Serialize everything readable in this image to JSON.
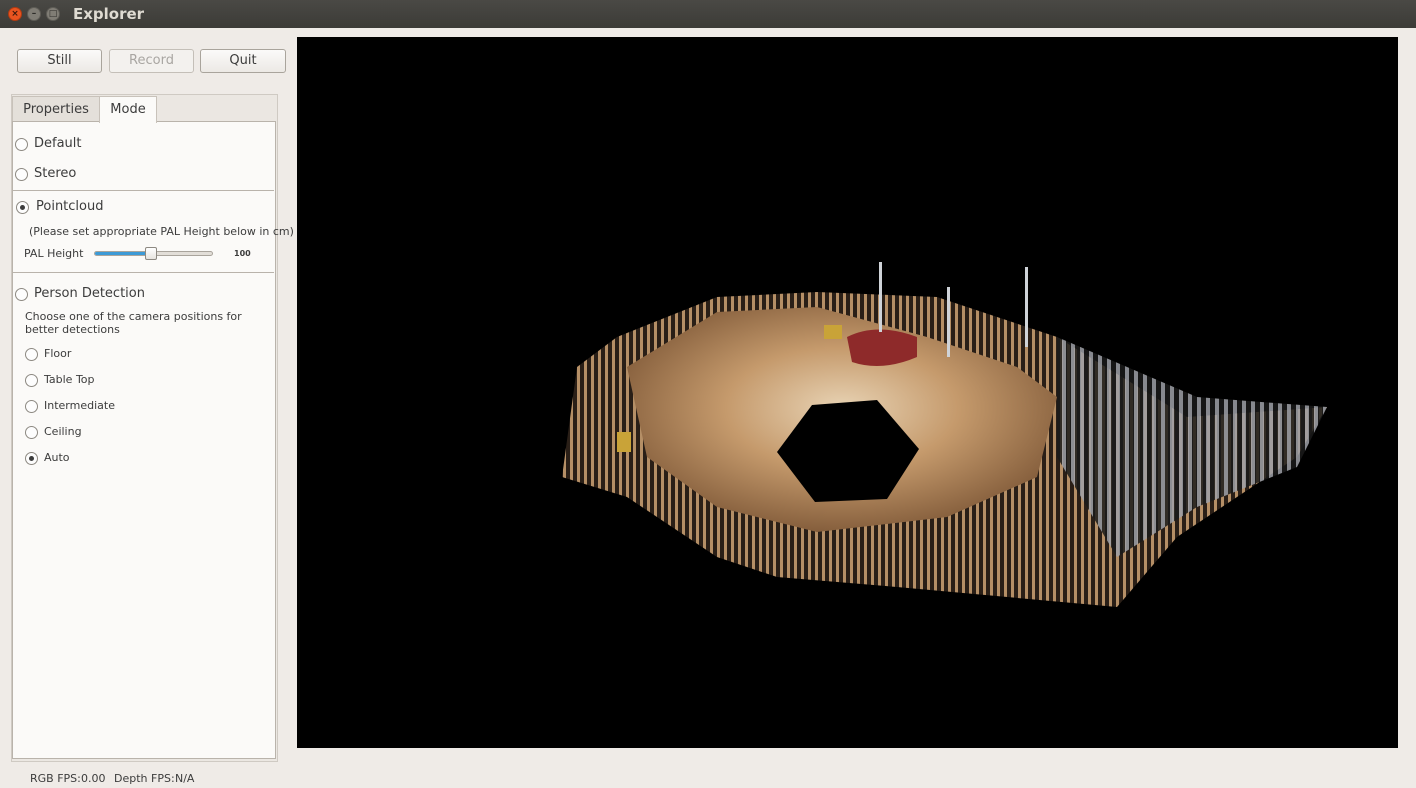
{
  "window": {
    "title": "Explorer"
  },
  "toolbar": {
    "still_label": "Still",
    "record_label": "Record",
    "quit_label": "Quit"
  },
  "tabs": [
    {
      "label": "Properties",
      "active": false
    },
    {
      "label": "Mode",
      "active": true
    }
  ],
  "mode": {
    "default_label": "Default",
    "stereo_label": "Stereo",
    "pointcloud_label": "Pointcloud",
    "pointcloud_selected": true,
    "pointcloud_hint": "(Please set appropriate PAL Height below in cm)",
    "pal_height_label": "PAL Height",
    "pal_height_value": "100",
    "pal_height_fraction": 0.48,
    "person_detection_label": "Person Detection",
    "person_detection_hint": "Choose one of the camera positions for better detections",
    "positions": [
      {
        "label": "Floor",
        "selected": false
      },
      {
        "label": "Table Top",
        "selected": false
      },
      {
        "label": "Intermediate",
        "selected": false
      },
      {
        "label": "Ceiling",
        "selected": false
      },
      {
        "label": "Auto",
        "selected": true
      }
    ]
  },
  "status": {
    "rgb_fps_label": "RGB FPS:",
    "rgb_fps_value": "0.00",
    "depth_fps_label": "Depth FPS:",
    "depth_fps_value": "N/A"
  },
  "colors": {
    "accent": "#3c9ad6",
    "close_button": "#e95420",
    "viewer_background": "#000000"
  },
  "icons": [
    "close-icon",
    "minimize-icon",
    "maximize-icon"
  ]
}
